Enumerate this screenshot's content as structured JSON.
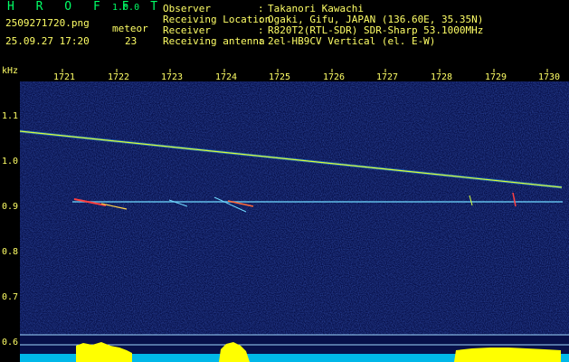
{
  "header": {
    "app_title": "H R O F F T",
    "version": "1.0.0",
    "filename": "2509271720.png",
    "datetime": "25.09.27 17:20",
    "meteor_label": "meteor",
    "meteor_count": "23"
  },
  "info": [
    {
      "label": "Observer",
      "value": "Takanori Kawachi"
    },
    {
      "label": "Receiving Location",
      "value": "Ogaki, Gifu, JAPAN (136.60E, 35.35N)"
    },
    {
      "label": "Receiver",
      "value": "R820T2(RTL-SDR) SDR-Sharp 53.1000MHz"
    },
    {
      "label": "Receiving antenna",
      "value": "2el-HB9CV Vertical (el. E-W)"
    }
  ],
  "axes": {
    "y_unit": "kHz",
    "y_ticks": [
      "1.1",
      "1.0",
      "0.9",
      "0.8",
      "0.7",
      "0.6"
    ],
    "x_ticks": [
      "1721",
      "1722",
      "1723",
      "1724",
      "1725",
      "1726",
      "1727",
      "1728",
      "1729",
      "1730"
    ]
  },
  "colors": {
    "background": "#000000",
    "spectrum_bg": "#07104a",
    "label_yellow": "#ffff66",
    "title_green": "#00ff66",
    "trace_main": "#d6ff3a",
    "trace_carrier": "#6fd8ff",
    "level_yellow": "#ffff00",
    "level_cyan": "#00d8ff"
  }
}
